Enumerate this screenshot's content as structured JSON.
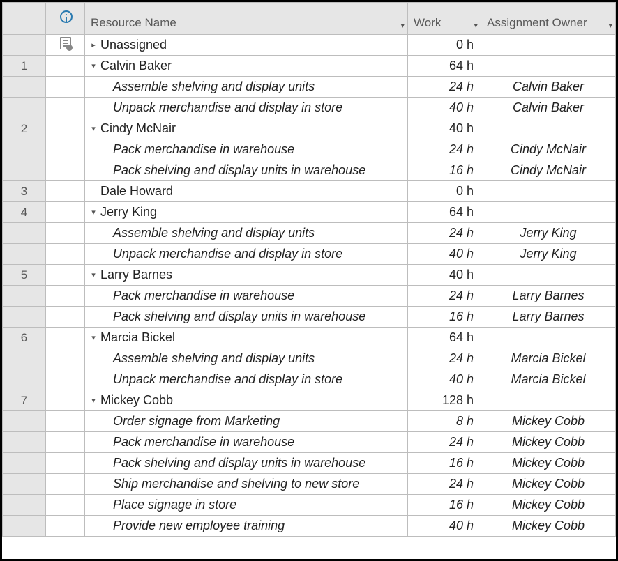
{
  "columns": {
    "resource_name": "Resource Name",
    "work": "Work",
    "assignment_owner": "Assignment Owner"
  },
  "rows": [
    {
      "num": "",
      "icon": "doc",
      "expand": "right",
      "indent": 0,
      "name": "Unassigned",
      "work": "0 h",
      "owner": "",
      "italic": false
    },
    {
      "num": "1",
      "icon": "",
      "expand": "down",
      "indent": 0,
      "name": "Calvin Baker",
      "work": "64 h",
      "owner": "",
      "italic": false
    },
    {
      "num": "",
      "icon": "",
      "expand": "",
      "indent": 1,
      "name": "Assemble shelving and display units",
      "work": "24 h",
      "owner": "Calvin Baker",
      "italic": true
    },
    {
      "num": "",
      "icon": "",
      "expand": "",
      "indent": 1,
      "name": "Unpack merchandise and display in store",
      "work": "40 h",
      "owner": "Calvin Baker",
      "italic": true
    },
    {
      "num": "2",
      "icon": "",
      "expand": "down",
      "indent": 0,
      "name": "Cindy McNair",
      "work": "40 h",
      "owner": "",
      "italic": false
    },
    {
      "num": "",
      "icon": "",
      "expand": "",
      "indent": 1,
      "name": "Pack merchandise in warehouse",
      "work": "24 h",
      "owner": "Cindy McNair",
      "italic": true
    },
    {
      "num": "",
      "icon": "",
      "expand": "",
      "indent": 1,
      "name": "Pack shelving and display units in warehouse",
      "work": "16 h",
      "owner": "Cindy McNair",
      "italic": true
    },
    {
      "num": "3",
      "icon": "",
      "expand": "",
      "indent": 0,
      "name": "Dale Howard",
      "work": "0 h",
      "owner": "",
      "italic": false
    },
    {
      "num": "4",
      "icon": "",
      "expand": "down",
      "indent": 0,
      "name": "Jerry King",
      "work": "64 h",
      "owner": "",
      "italic": false
    },
    {
      "num": "",
      "icon": "",
      "expand": "",
      "indent": 1,
      "name": "Assemble shelving and display units",
      "work": "24 h",
      "owner": "Jerry King",
      "italic": true
    },
    {
      "num": "",
      "icon": "",
      "expand": "",
      "indent": 1,
      "name": "Unpack merchandise and display in store",
      "work": "40 h",
      "owner": "Jerry King",
      "italic": true
    },
    {
      "num": "5",
      "icon": "",
      "expand": "down",
      "indent": 0,
      "name": "Larry Barnes",
      "work": "40 h",
      "owner": "",
      "italic": false
    },
    {
      "num": "",
      "icon": "",
      "expand": "",
      "indent": 1,
      "name": "Pack merchandise in warehouse",
      "work": "24 h",
      "owner": "Larry Barnes",
      "italic": true
    },
    {
      "num": "",
      "icon": "",
      "expand": "",
      "indent": 1,
      "name": "Pack shelving and display units in warehouse",
      "work": "16 h",
      "owner": "Larry Barnes",
      "italic": true
    },
    {
      "num": "6",
      "icon": "",
      "expand": "down",
      "indent": 0,
      "name": "Marcia Bickel",
      "work": "64 h",
      "owner": "",
      "italic": false
    },
    {
      "num": "",
      "icon": "",
      "expand": "",
      "indent": 1,
      "name": "Assemble shelving and display units",
      "work": "24 h",
      "owner": "Marcia Bickel",
      "italic": true
    },
    {
      "num": "",
      "icon": "",
      "expand": "",
      "indent": 1,
      "name": "Unpack merchandise and display in store",
      "work": "40 h",
      "owner": "Marcia Bickel",
      "italic": true
    },
    {
      "num": "7",
      "icon": "",
      "expand": "down",
      "indent": 0,
      "name": "Mickey Cobb",
      "work": "128 h",
      "owner": "",
      "italic": false
    },
    {
      "num": "",
      "icon": "",
      "expand": "",
      "indent": 1,
      "name": "Order signage from Marketing",
      "work": "8 h",
      "owner": "Mickey Cobb",
      "italic": true
    },
    {
      "num": "",
      "icon": "",
      "expand": "",
      "indent": 1,
      "name": "Pack merchandise in warehouse",
      "work": "24 h",
      "owner": "Mickey Cobb",
      "italic": true
    },
    {
      "num": "",
      "icon": "",
      "expand": "",
      "indent": 1,
      "name": "Pack shelving and display units in warehouse",
      "work": "16 h",
      "owner": "Mickey Cobb",
      "italic": true
    },
    {
      "num": "",
      "icon": "",
      "expand": "",
      "indent": 1,
      "name": "Ship merchandise and shelving to new store",
      "work": "24 h",
      "owner": "Mickey Cobb",
      "italic": true
    },
    {
      "num": "",
      "icon": "",
      "expand": "",
      "indent": 1,
      "name": "Place signage in store",
      "work": "16 h",
      "owner": "Mickey Cobb",
      "italic": true
    },
    {
      "num": "",
      "icon": "",
      "expand": "",
      "indent": 1,
      "name": "Provide new employee training",
      "work": "40 h",
      "owner": "Mickey Cobb",
      "italic": true
    }
  ]
}
